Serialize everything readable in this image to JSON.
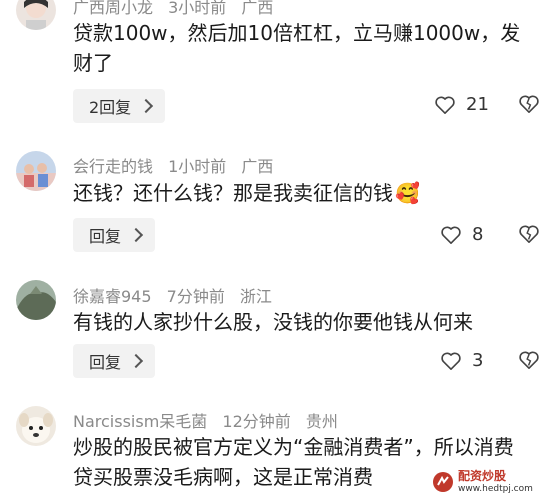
{
  "comments": [
    {
      "user": "广西周小龙",
      "time": "3小时前",
      "region": "广西",
      "text": "贷款100w，然后加10倍杠杠，立马赚1000w，发财了",
      "reply_label": "2回复",
      "likes": "21",
      "avatar_color": "#d9c7c0"
    },
    {
      "user": "会行走的钱",
      "time": "1小时前",
      "region": "广西",
      "text": "还钱？还什么钱？那是我卖征信的钱",
      "emoji": "🥰",
      "reply_label": "回复",
      "likes": "8",
      "avatar_color": "#b8c9e0"
    },
    {
      "user": "徐嘉睿945",
      "time": "7分钟前",
      "region": "浙江",
      "text": "有钱的人家抄什么股，没钱的你要他钱从何来",
      "reply_label": "回复",
      "likes": "3",
      "avatar_color": "#6f7d6a"
    },
    {
      "user": "Narcissism呆毛菌",
      "time": "12分钟前",
      "region": "贵州",
      "text": "炒股的股民被官方定义为“金融消费者”，所以消费贷买股票没毛病啊，这是正常消费",
      "avatar_color": "#e8e0d4"
    }
  ],
  "watermark": {
    "line1": "配资炒股",
    "line2": "www.hedtpj.com",
    "accent": "#c0392b"
  }
}
